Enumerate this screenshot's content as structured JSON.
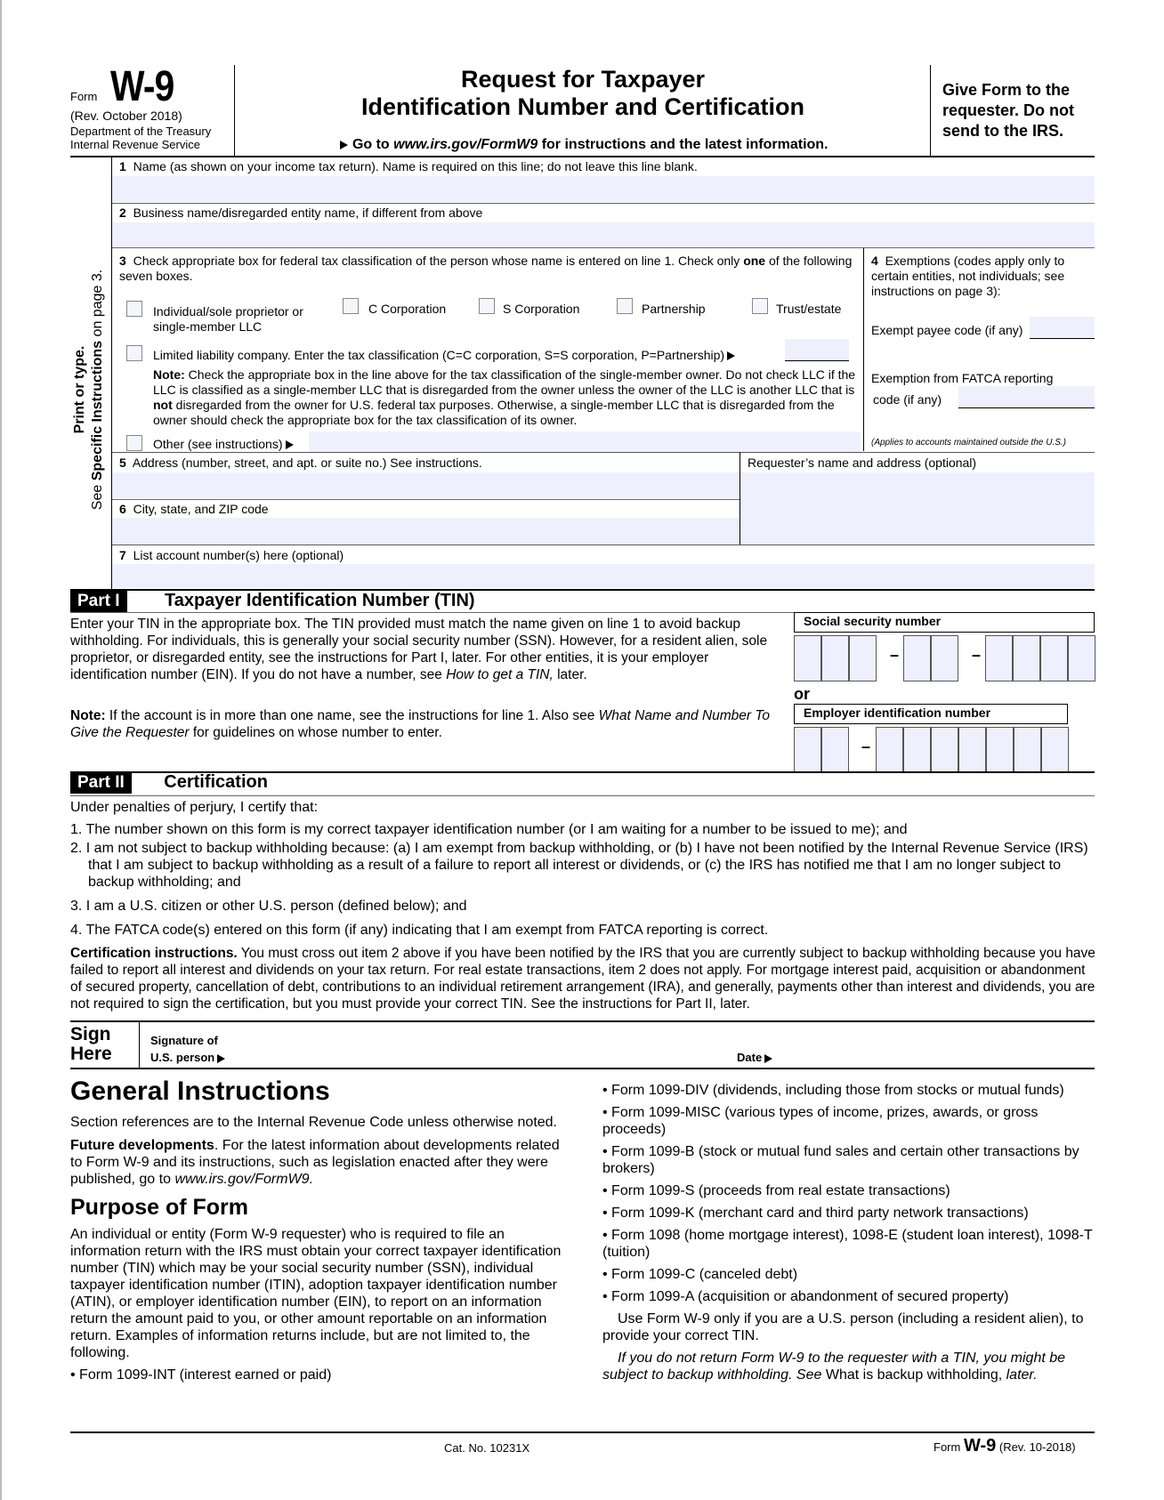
{
  "header": {
    "form_word": "Form",
    "form_number": "W-9",
    "revision": "(Rev. October 2018)",
    "department": "Department of the Treasury",
    "agency": "Internal Revenue Service",
    "title_line1": "Request for Taxpayer",
    "title_line2": "Identification Number and Certification",
    "goto_prefix": "Go to",
    "goto_url": "www.irs.gov/FormW9",
    "goto_suffix": "for instructions and the latest information.",
    "give_form": "Give Form to the requester. Do not send to the IRS."
  },
  "side": {
    "line1": "Print or type.",
    "line2_pre": "See",
    "line2_bold": "Specific Instructions",
    "line2_post": "on page 3."
  },
  "lines": {
    "line1": {
      "num": "1",
      "label": "Name (as shown on your income tax return). Name is required on this line; do not leave this line blank.",
      "value": ""
    },
    "line2": {
      "num": "2",
      "label": "Business name/disregarded entity name, if different from above",
      "value": ""
    },
    "line3": {
      "num": "3",
      "label_a": "Check appropriate box for federal tax classification of the person whose name is entered on line 1. Check only",
      "label_bold": "one",
      "label_b": "of the following seven boxes.",
      "options": [
        {
          "label": "Individual/sole proprietor or single-member LLC",
          "checked": false
        },
        {
          "label": "C Corporation",
          "checked": false
        },
        {
          "label": "S Corporation",
          "checked": false
        },
        {
          "label": "Partnership",
          "checked": false
        },
        {
          "label": "Trust/estate",
          "checked": false
        }
      ],
      "llc_label": "Limited liability company. Enter the tax classification (C=C corporation, S=S corporation, P=Partnership)",
      "llc_value": "",
      "note_bold": "Note:",
      "note_a": "Check the appropriate box in the line above for the tax classification of the single-member owner.  Do not check LLC if the LLC is classified as a single-member LLC that is disregarded from the owner unless the owner of the LLC is another LLC that is",
      "note_not": "not",
      "note_b": "disregarded from the owner for U.S. federal tax purposes. Otherwise, a single-member LLC that is disregarded from the owner should check the appropriate box for the tax classification of its owner.",
      "other_label": "Other (see instructions)",
      "other_value": ""
    },
    "line4": {
      "num": "4",
      "label": "Exemptions (codes apply only to certain entities, not individuals; see instructions on page 3):",
      "exempt_payee_label": "Exempt payee code (if any)",
      "exempt_payee_value": "",
      "fatca_label_1": "Exemption from FATCA reporting",
      "fatca_label_2": "code (if any)",
      "fatca_value": "",
      "fatca_note": "(Applies to accounts maintained outside the U.S.)"
    },
    "line5": {
      "num": "5",
      "label": "Address (number, street, and apt. or suite no.) See instructions.",
      "value": ""
    },
    "requester": {
      "label": "Requester’s name and address (optional)",
      "value": ""
    },
    "line6": {
      "num": "6",
      "label": "City, state, and ZIP code",
      "value": ""
    },
    "line7": {
      "num": "7",
      "label": "List account number(s) here (optional)",
      "value": ""
    }
  },
  "part1": {
    "tag": "Part I",
    "title": "Taxpayer Identification Number (TIN)",
    "para_a": "Enter your TIN in the appropriate box. The TIN provided must match the name given on line 1 to avoid backup withholding. For individuals, this is generally your social security number (SSN). However, for a resident alien, sole proprietor, or disregarded entity, see the instructions for Part I, later. For other entities, it is your employer identification number (EIN). If you do not have a number, see",
    "para_italic": "How to get a TIN,",
    "para_b": "later.",
    "note_bold": "Note:",
    "note_a": "If the account is in more than one name, see the instructions for line 1. Also see",
    "note_italic": "What Name and Number To Give the Requester",
    "note_b": "for guidelines on whose number to enter.",
    "ssn_label": "Social security number",
    "ssn_digits": [
      "",
      "",
      "",
      "",
      "",
      "",
      "",
      "",
      ""
    ],
    "or": "or",
    "ein_label": "Employer identification number",
    "ein_digits": [
      "",
      "",
      "",
      "",
      "",
      "",
      "",
      "",
      ""
    ],
    "dash": "–"
  },
  "part2": {
    "tag": "Part II",
    "title": "Certification",
    "intro": "Under penalties of perjury, I certify that:",
    "items": [
      "1. The number shown on this form is my correct taxpayer identification number (or I am waiting for a number to be issued to me); and",
      "2. I am not subject to backup withholding because: (a) I am exempt from backup withholding, or (b) I have not been notified by the Internal Revenue Service (IRS) that I am subject to backup withholding as a result of a failure to report all interest or dividends, or (c) the IRS has notified me that I am no longer subject to backup withholding; and",
      "3. I am a U.S. citizen or other U.S. person (defined below); and",
      "4. The FATCA code(s) entered on this form (if any) indicating that I am exempt from FATCA reporting is correct."
    ],
    "cert_bold": "Certification instructions.",
    "cert_text": "You must cross out item 2 above if you have been notified by the IRS that you are currently subject to backup withholding because you have failed to report all interest and dividends on your tax return. For real estate transactions, item 2 does not apply. For mortgage interest paid, acquisition or abandonment of secured property, cancellation of debt, contributions to an individual retirement arrangement (IRA), and generally, payments other than interest and dividends, you are not required to sign the certification, but you must provide your correct TIN. See the instructions for Part II, later."
  },
  "sign": {
    "sign": "Sign",
    "here": "Here",
    "sig_label_1": "Signature of",
    "sig_label_2": "U.S. person",
    "date_label": "Date"
  },
  "general": {
    "heading": "General Instructions",
    "section_refs": "Section references are to the Internal Revenue Code unless otherwise noted.",
    "future_bold": "Future developments",
    "future_text": ". For the latest information about developments related to Form W-9 and its instructions, such as legislation enacted after they were published, go to",
    "future_url": "www.irs.gov/FormW9.",
    "purpose_heading": "Purpose of Form",
    "purpose_text": "An individual or entity (Form W-9 requester) who is required to file an information return with the IRS must obtain your correct taxpayer identification number (TIN) which may be your social security number (SSN), individual taxpayer identification number (ITIN), adoption taxpayer identification number (ATIN), or employer identification number (EIN), to report on an information return the amount paid to you, or other amount reportable on an information return. Examples of information returns include, but are not limited to, the following.",
    "bullet_left": "• Form 1099-INT (interest earned or paid)",
    "bullets_right": [
      "• Form 1099-DIV (dividends, including those from stocks or mutual funds)",
      "• Form 1099-MISC (various types of income, prizes, awards, or gross proceeds)",
      "• Form 1099-B (stock or mutual fund sales and certain other transactions by brokers)",
      "• Form 1099-S (proceeds from real estate transactions)",
      "• Form 1099-K (merchant card and third party network transactions)",
      "• Form 1098 (home mortgage interest), 1098-E (student loan interest), 1098-T (tuition)",
      "• Form 1099-C (canceled debt)",
      "• Form 1099-A (acquisition or abandonment of secured property)"
    ],
    "use_form": "Use Form W-9 only if you are a U.S. person (including a resident alien), to provide your correct TIN.",
    "if_not_italic": "If you do not return Form W-9 to the requester with a TIN, you might be subject to backup withholding. See",
    "if_not_plain": "What is backup withholding,",
    "if_not_later": "later."
  },
  "footer": {
    "cat_no": "Cat. No. 10231X",
    "form_word": "Form",
    "form_number": "W-9",
    "rev": "(Rev. 10-2018)"
  }
}
